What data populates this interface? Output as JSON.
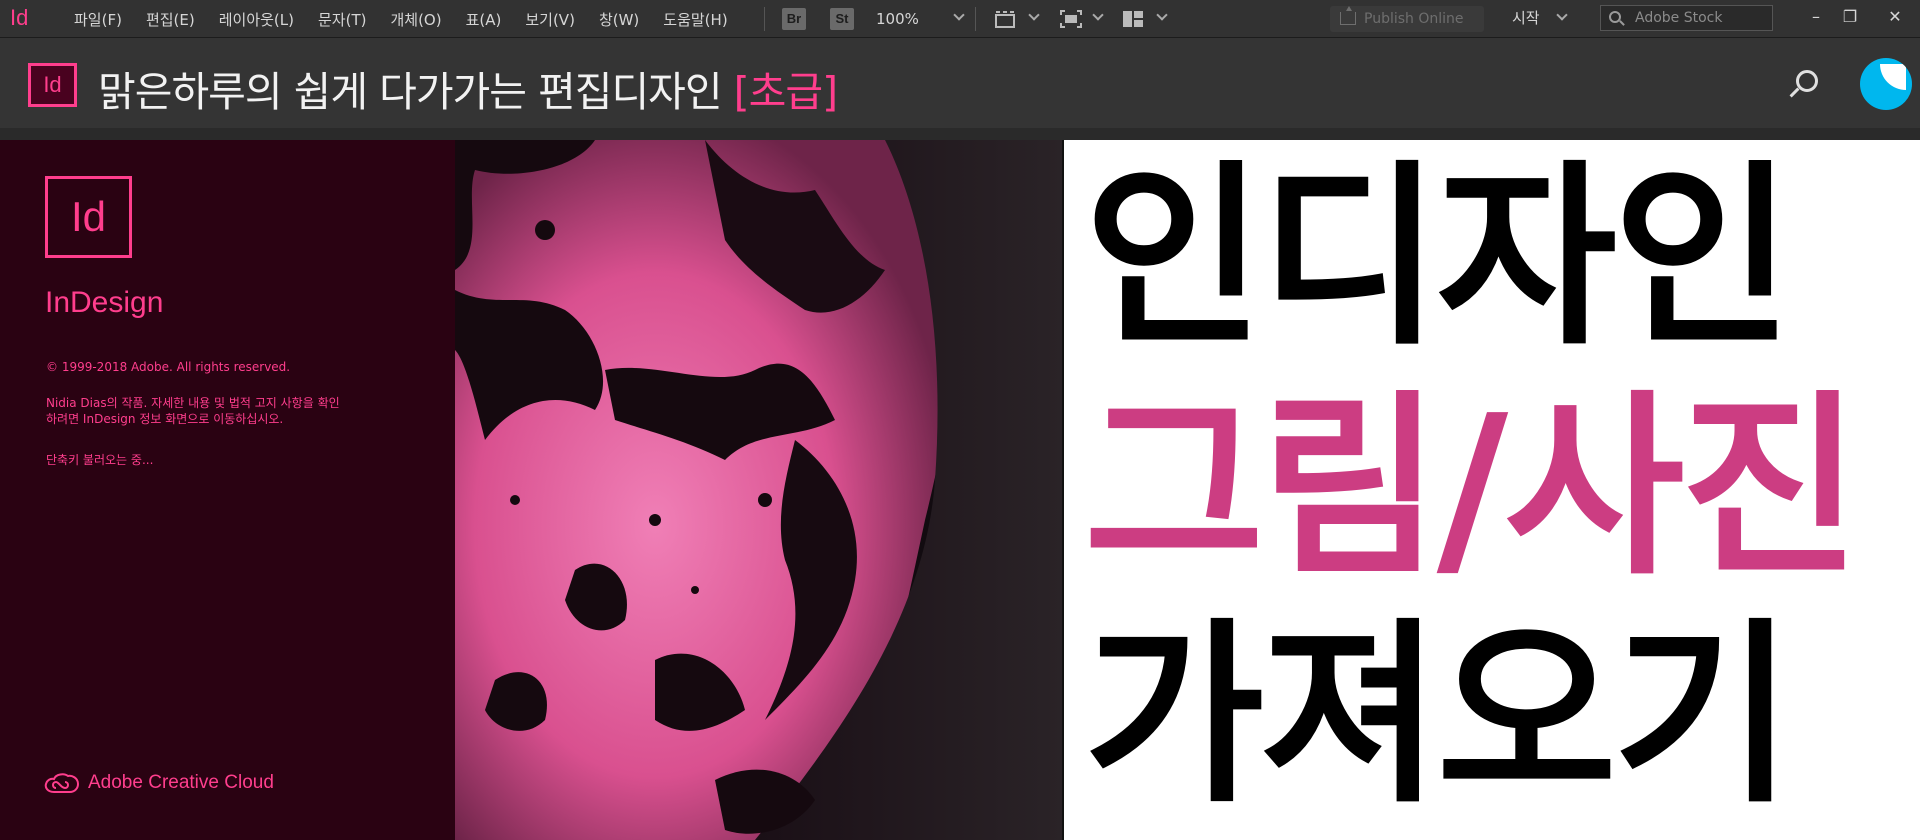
{
  "menubar": {
    "app_logo": "Id",
    "items": [
      "파일(F)",
      "편집(E)",
      "레이아웃(L)",
      "문자(T)",
      "개체(O)",
      "표(A)",
      "보기(V)",
      "창(W)",
      "도움말(H)"
    ],
    "bridge_label": "Br",
    "stock_label": "St",
    "zoom": "100%",
    "publish_label": "Publish Online",
    "workspace_label": "시작",
    "stock_search_placeholder": "Adobe Stock",
    "minimize": "–",
    "restore": "❐",
    "close": "✕"
  },
  "banner": {
    "logo": "Id",
    "title": "맑은하루의 쉽게 다가가는 편집디자인 ",
    "title_accent": "[초급]"
  },
  "splash": {
    "logo": "Id",
    "product_name": "InDesign",
    "copyright": "© 1999-2018 Adobe. All rights reserved.",
    "credit_line1": "Nidia Dias의 작품. 자세한 내용 및 법적 고지 사항을 확인",
    "credit_line2": "하려면 InDesign 정보 화면으로 이동하십시오.",
    "loading": "단축키 불러오는 중...",
    "brand": "Adobe Creative Cloud"
  },
  "headline": {
    "line1": "인디자인",
    "line2": "그림/사진",
    "line3": "가져오기"
  },
  "colors": {
    "accent": "#ff3e8d",
    "headline_pink": "#cc3d82",
    "splash_bg": "#2a0212"
  }
}
